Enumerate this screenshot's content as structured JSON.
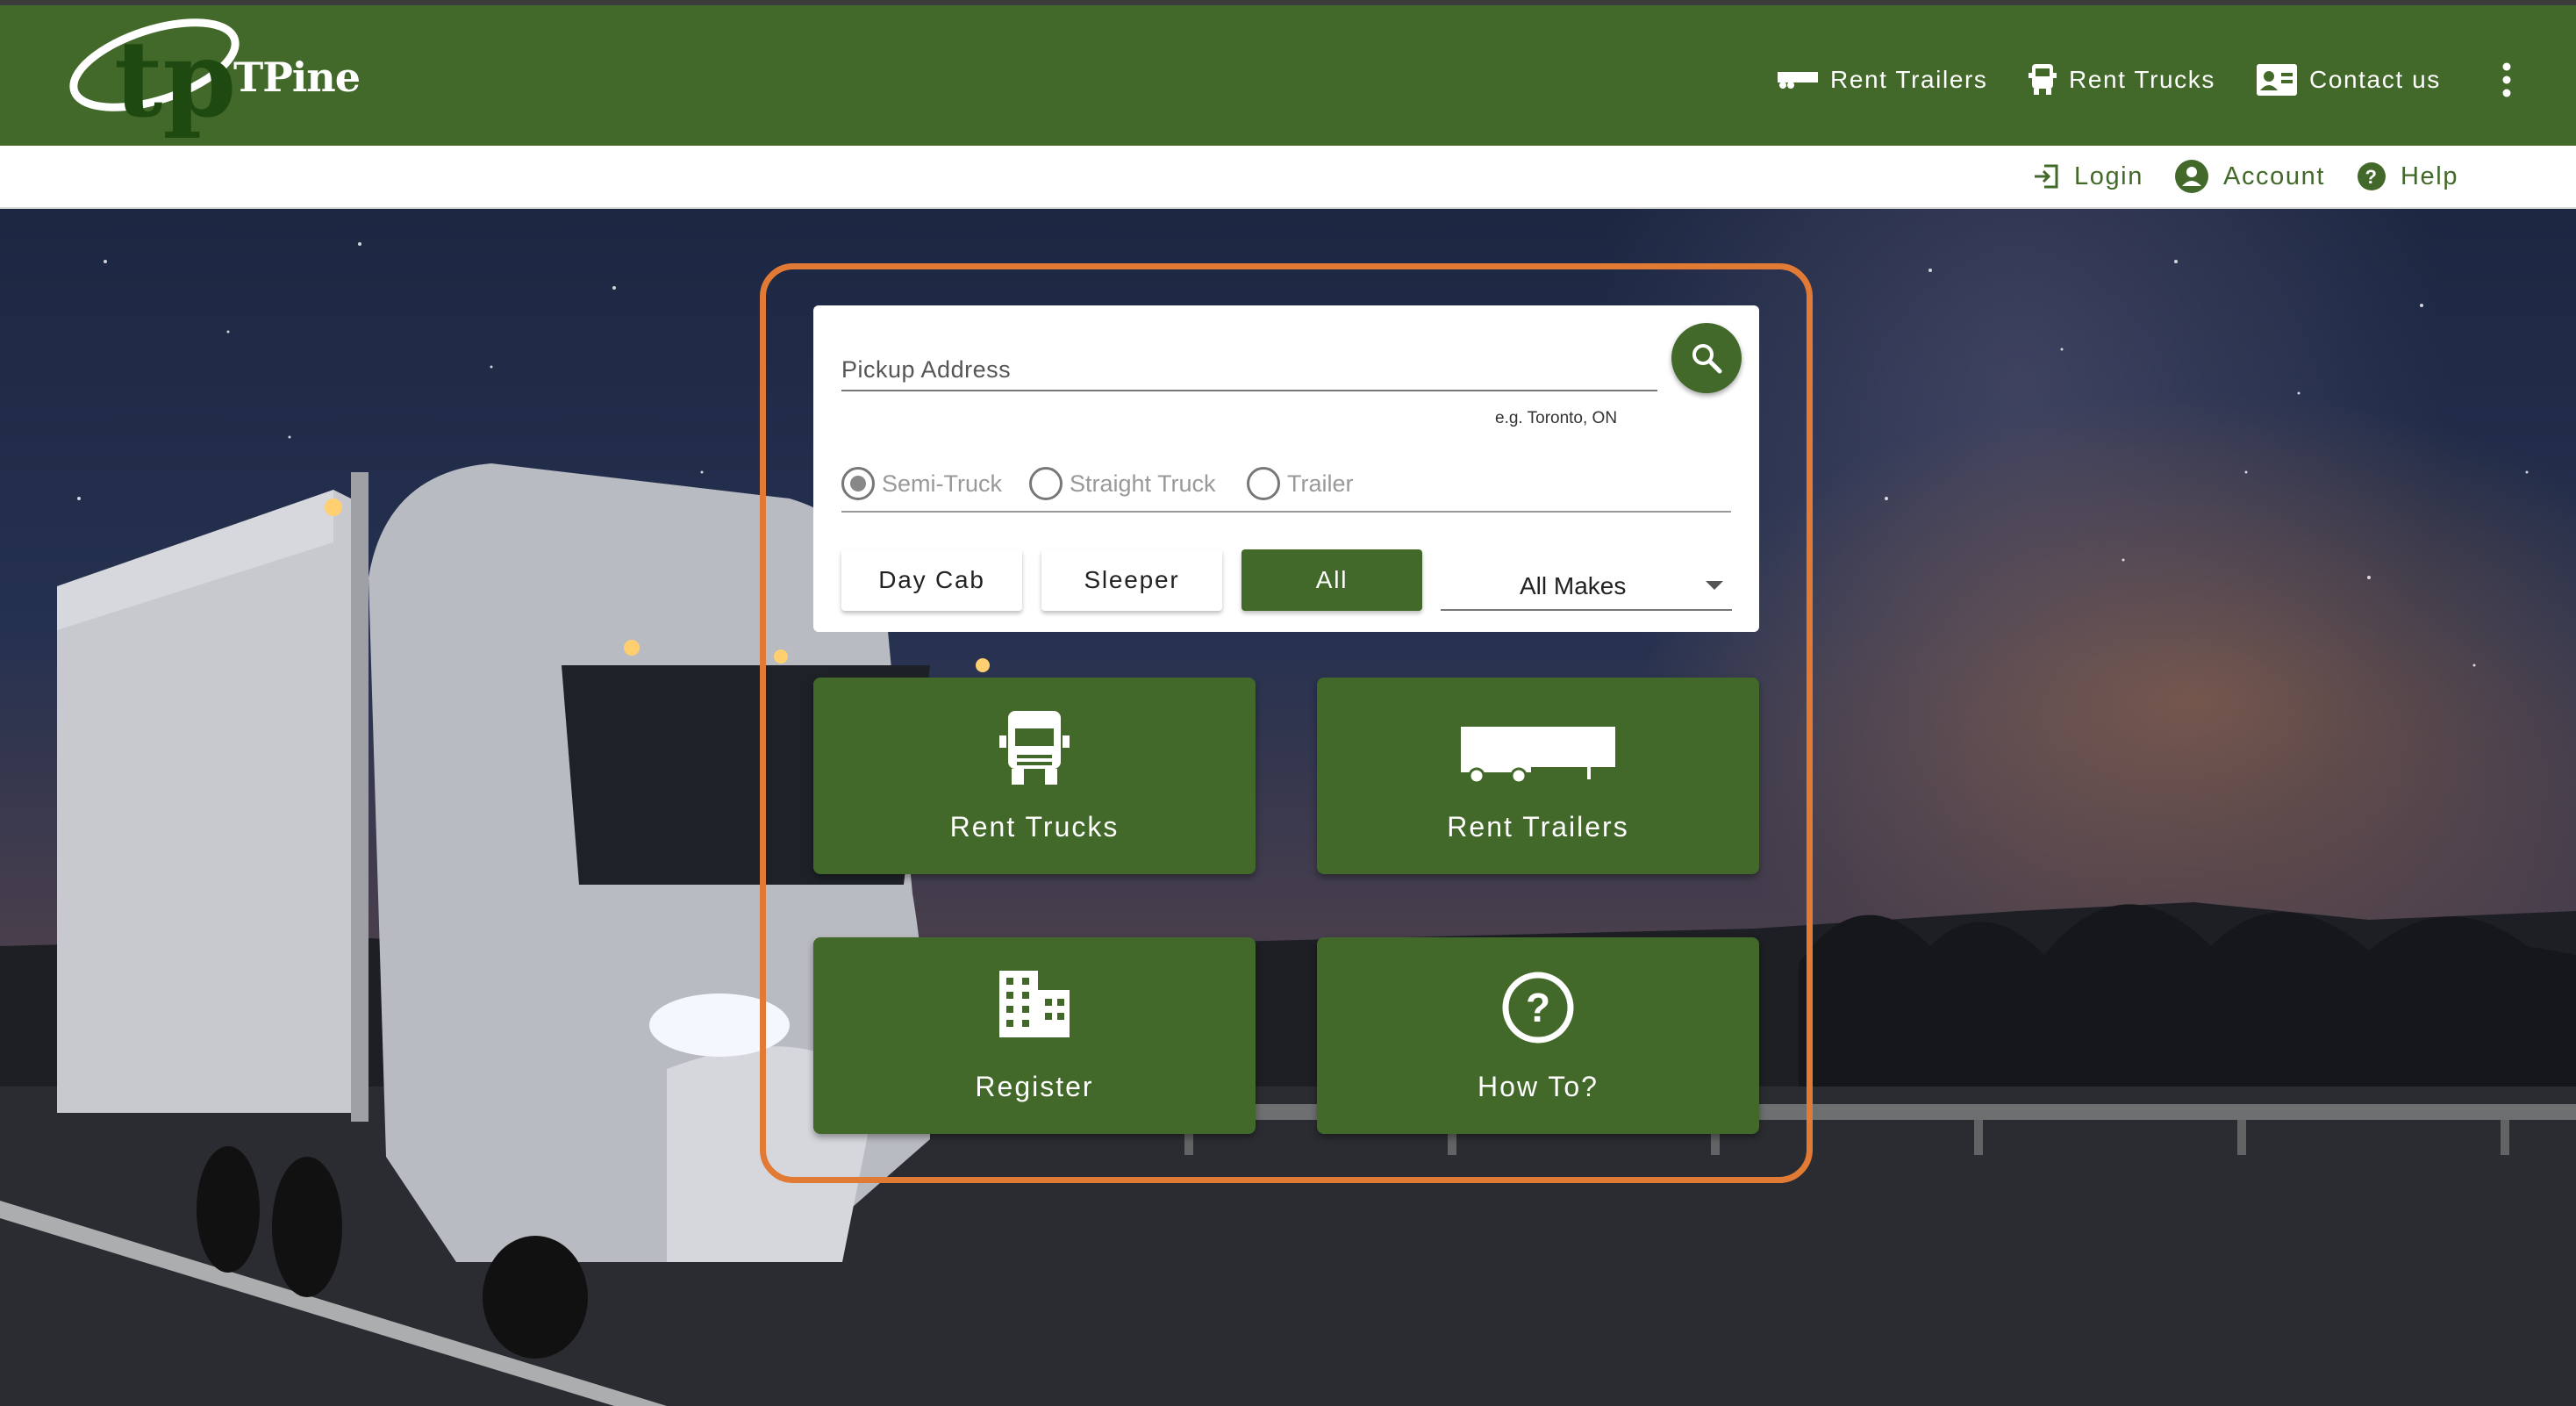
{
  "brand": {
    "name": "TPine",
    "logo_letters": "tp"
  },
  "colors": {
    "brand_green": "#43692a",
    "frame_orange": "#e07a35",
    "subbar_text": "#43692a"
  },
  "nav": {
    "items": [
      {
        "label": "Rent Trailers",
        "icon": "trailer-icon"
      },
      {
        "label": "Rent Trucks",
        "icon": "truck-icon"
      },
      {
        "label": "Contact us",
        "icon": "contact-card-icon"
      }
    ],
    "more_icon": "more-vertical-icon"
  },
  "subnav": {
    "items": [
      {
        "label": "Login",
        "icon": "login-icon"
      },
      {
        "label": "Account",
        "icon": "account-circle-icon"
      },
      {
        "label": "Help",
        "icon": "help-circle-icon"
      }
    ]
  },
  "search": {
    "pickup_label": "Pickup Address",
    "pickup_value": "",
    "hint": "e.g. Toronto, ON",
    "button_icon": "search-icon"
  },
  "vehicle_type": {
    "options": [
      "Semi-Truck",
      "Straight Truck",
      "Trailer"
    ],
    "selected": "Semi-Truck"
  },
  "cab_type": {
    "options": [
      "Day Cab",
      "Sleeper",
      "All"
    ],
    "selected": "All"
  },
  "makes": {
    "selected": "All Makes"
  },
  "tiles": [
    {
      "label": "Rent Trucks",
      "icon": "truck-front-icon"
    },
    {
      "label": "Rent Trailers",
      "icon": "trailer-icon"
    },
    {
      "label": "Register",
      "icon": "building-icon"
    },
    {
      "label": "How To?",
      "icon": "help-circle-icon"
    }
  ]
}
